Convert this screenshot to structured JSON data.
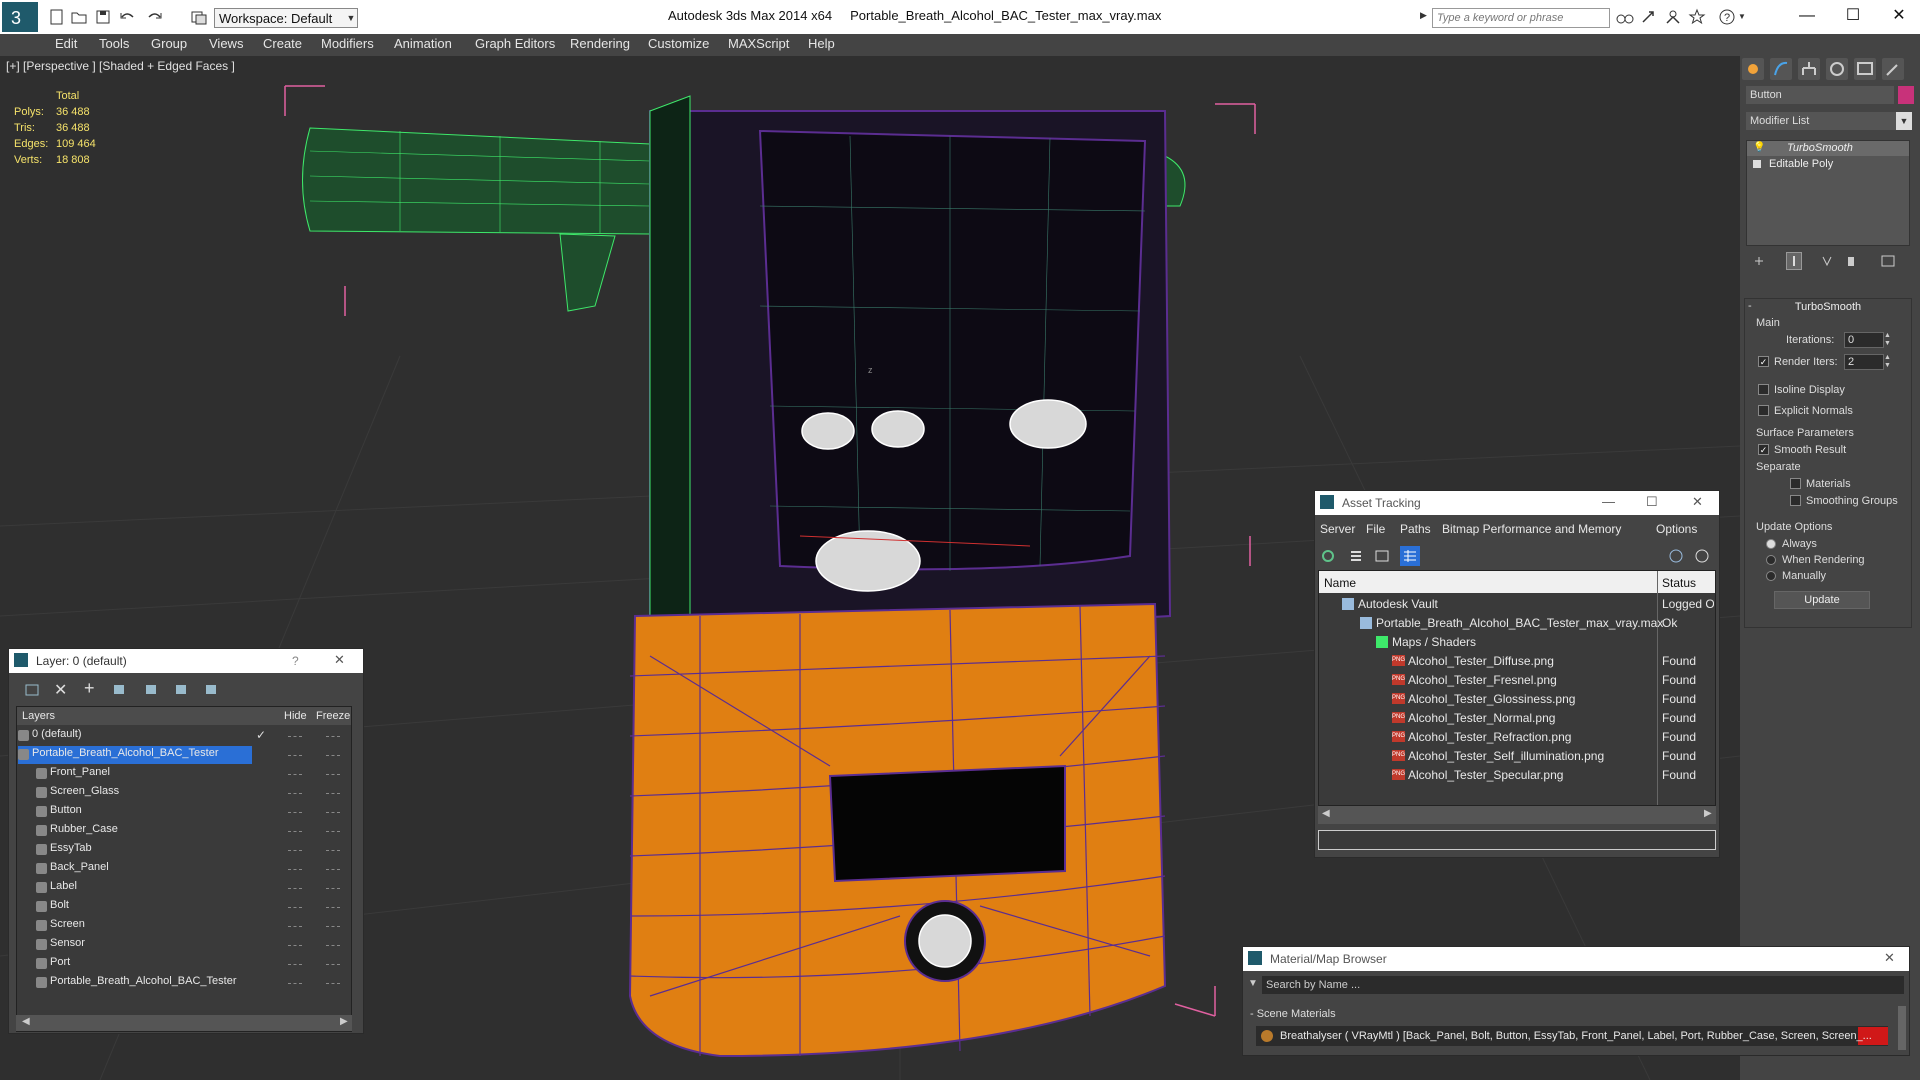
{
  "window": {
    "app_title": "Autodesk 3ds Max  2014 x64",
    "file_title": "Portable_Breath_Alcohol_BAC_Tester_max_vray.max",
    "workspace": "Workspace: Default",
    "search_placeholder": "Type a keyword or phrase"
  },
  "menu": [
    "Edit",
    "Tools",
    "Group",
    "Views",
    "Create",
    "Modifiers",
    "Animation",
    "Graph Editors",
    "Rendering",
    "Customize",
    "MAXScript",
    "Help"
  ],
  "viewport": {
    "label": "[+] [Perspective ] [Shaded + Edged Faces ]",
    "stats": {
      "header": "Total",
      "rows": [
        {
          "label": "Polys:",
          "value": "36 488"
        },
        {
          "label": "Tris:",
          "value": "36 488"
        },
        {
          "label": "Edges:",
          "value": "109 464"
        },
        {
          "label": "Verts:",
          "value": "18 808"
        }
      ]
    },
    "axis_label": "z"
  },
  "command_panel": {
    "object_name": "Button",
    "modifier_list": "Modifier List",
    "stack": [
      "TurboSmooth",
      "Editable Poly"
    ],
    "rollout_title": "TurboSmooth",
    "main_label": "Main",
    "iterations_label": "Iterations:",
    "iterations_value": "0",
    "render_iters_label": "Render Iters:",
    "render_iters_value": "2",
    "isoline": "Isoline Display",
    "explicit_normals": "Explicit Normals",
    "surface_params": "Surface Parameters",
    "smooth_result": "Smooth Result",
    "separate": "Separate",
    "materials": "Materials",
    "smoothing_groups": "Smoothing Groups",
    "update_options": "Update Options",
    "always": "Always",
    "when_rendering": "When Rendering",
    "manually": "Manually",
    "update_button": "Update"
  },
  "layer_panel": {
    "title": "Layer: 0 (default)",
    "help": "?",
    "columns": [
      "Layers",
      "Hide",
      "Freeze"
    ],
    "rows": [
      "0 (default)",
      "Portable_Breath_Alcohol_BAC_Tester",
      "Front_Panel",
      "Screen_Glass",
      "Button",
      "Rubber_Case",
      "EssyTab",
      "Back_Panel",
      "Label",
      "Bolt",
      "Screen",
      "Sensor",
      "Port",
      "Portable_Breath_Alcohol_BAC_Tester"
    ]
  },
  "asset_tracking": {
    "title": "Asset Tracking",
    "menu": [
      "Server",
      "File",
      "Paths",
      "Bitmap Performance and Memory",
      "Options"
    ],
    "columns": [
      "Name",
      "Status"
    ],
    "rows": [
      {
        "name": "Autodesk Vault",
        "status": "Logged Ou"
      },
      {
        "name": "Portable_Breath_Alcohol_BAC_Tester_max_vray.max",
        "status": "Ok"
      },
      {
        "name": "Maps / Shaders",
        "status": ""
      },
      {
        "name": "Alcohol_Tester_Diffuse.png",
        "status": "Found"
      },
      {
        "name": "Alcohol_Tester_Fresnel.png",
        "status": "Found"
      },
      {
        "name": "Alcohol_Tester_Glossiness.png",
        "status": "Found"
      },
      {
        "name": "Alcohol_Tester_Normal.png",
        "status": "Found"
      },
      {
        "name": "Alcohol_Tester_Refraction.png",
        "status": "Found"
      },
      {
        "name": "Alcohol_Tester_Self_illumination.png",
        "status": "Found"
      },
      {
        "name": "Alcohol_Tester_Specular.png",
        "status": "Found"
      }
    ]
  },
  "material_browser": {
    "title": "Material/Map Browser",
    "search": "Search by Name ...",
    "section": "- Scene Materials",
    "material": "Breathalyser  ( VRayMtl )  [Back_Panel, Bolt, Button, EssyTab, Front_Panel, Label, Port, Rubber_Case, Screen, Screen_..."
  },
  "colors": {
    "orange": "#e07f12",
    "wire": "#5b2d91",
    "green": "#3ee86a",
    "accent": "#2a6fd6"
  }
}
